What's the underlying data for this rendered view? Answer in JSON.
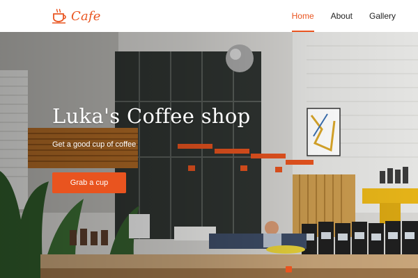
{
  "brand": {
    "name": "Cafe",
    "icon": "coffee-cup-icon",
    "color": "#e9541f"
  },
  "nav": {
    "items": [
      {
        "label": "Home",
        "active": true
      },
      {
        "label": "About",
        "active": false
      },
      {
        "label": "Gallery",
        "active": false
      }
    ]
  },
  "hero": {
    "title": "Luka's Coffee shop",
    "subtitle": "Get a good cup of coffee",
    "cta_label": "Grab a cup",
    "background": "coffee shop interior photo",
    "slides_total": 1,
    "active_slide": 1
  },
  "colors": {
    "accent": "#e9541f",
    "nav_bg": "#ffffff",
    "text": "#222222"
  }
}
